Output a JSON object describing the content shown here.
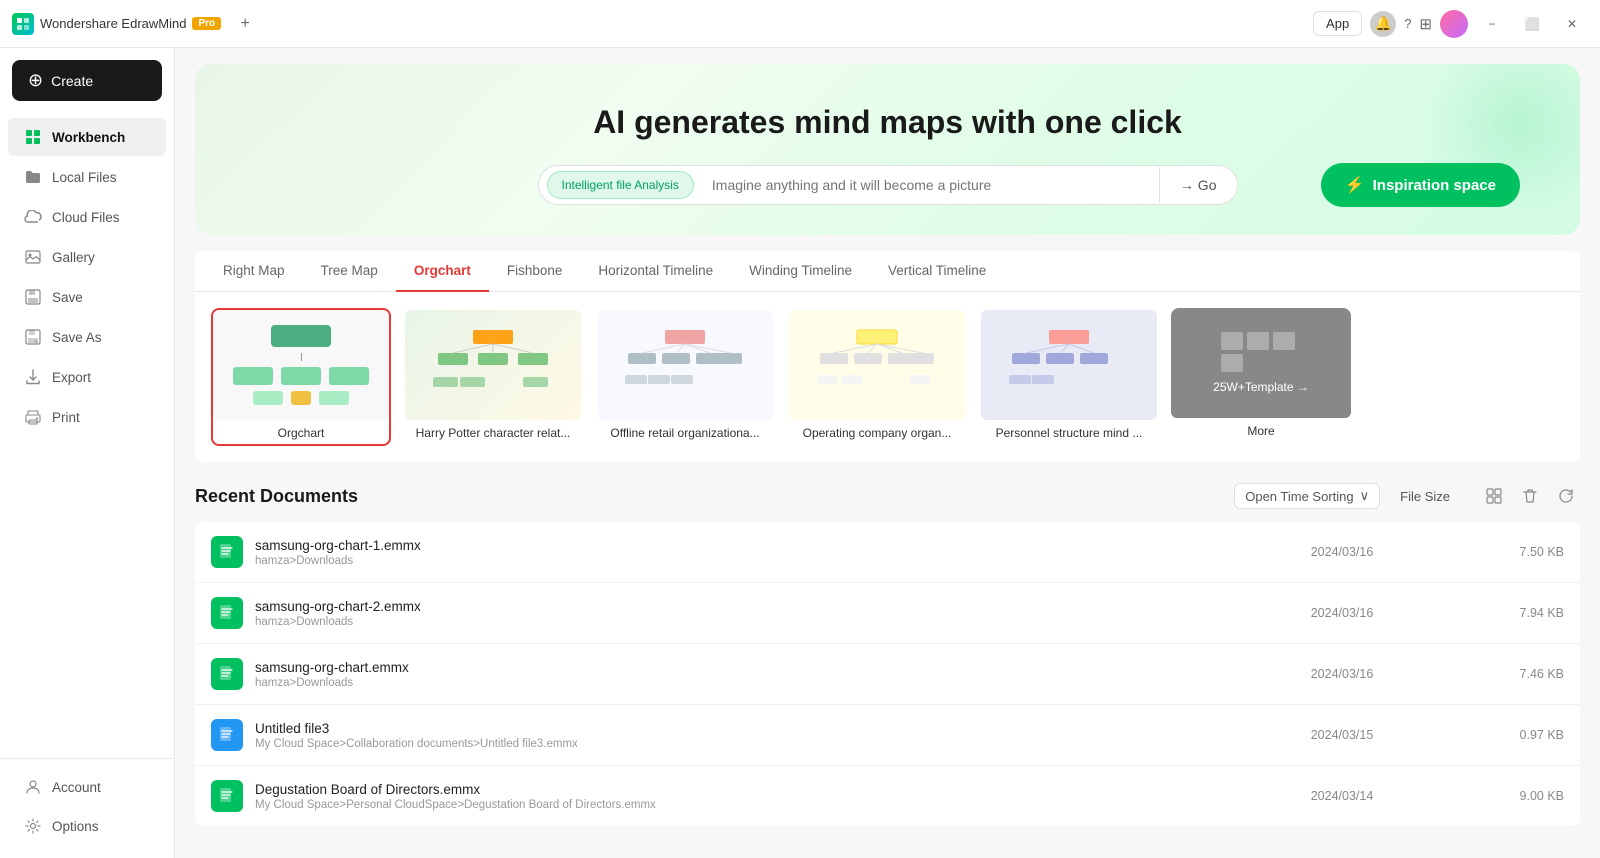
{
  "titleBar": {
    "appName": "Wondershare EdrawMind",
    "proBadge": "Pro",
    "addTabLabel": "+",
    "rightButtons": {
      "app": "App",
      "minimize": "−",
      "maximize": "⬜",
      "close": "✕"
    }
  },
  "sidebar": {
    "createLabel": "Create",
    "items": [
      {
        "id": "workbench",
        "label": "Workbench",
        "icon": "grid-icon",
        "active": true
      },
      {
        "id": "local-files",
        "label": "Local Files",
        "icon": "folder-icon",
        "active": false
      },
      {
        "id": "cloud-files",
        "label": "Cloud Files",
        "icon": "cloud-icon",
        "active": false
      },
      {
        "id": "gallery",
        "label": "Gallery",
        "icon": "gallery-icon",
        "active": false
      },
      {
        "id": "save",
        "label": "Save",
        "icon": "save-icon",
        "active": false
      },
      {
        "id": "save-as",
        "label": "Save As",
        "icon": "save-as-icon",
        "active": false
      },
      {
        "id": "export",
        "label": "Export",
        "icon": "export-icon",
        "active": false
      },
      {
        "id": "print",
        "label": "Print",
        "icon": "print-icon",
        "active": false
      }
    ],
    "bottomItems": [
      {
        "id": "account",
        "label": "Account",
        "icon": "account-icon"
      },
      {
        "id": "options",
        "label": "Options",
        "icon": "options-icon"
      }
    ]
  },
  "hero": {
    "title": "AI generates mind maps with one click",
    "searchTag": "Intelligent file Analysis",
    "searchPlaceholder": "Imagine anything and it will become a picture",
    "goLabel": "→ Go",
    "inspirationLabel": "Inspiration space"
  },
  "templateTabs": {
    "tabs": [
      {
        "id": "right-map",
        "label": "Right Map",
        "active": false
      },
      {
        "id": "tree-map",
        "label": "Tree Map",
        "active": false
      },
      {
        "id": "orgchart",
        "label": "Orgchart",
        "active": true
      },
      {
        "id": "fishbone",
        "label": "Fishbone",
        "active": false
      },
      {
        "id": "horizontal-timeline",
        "label": "Horizontal Timeline",
        "active": false
      },
      {
        "id": "winding-timeline",
        "label": "Winding Timeline",
        "active": false
      },
      {
        "id": "vertical-timeline",
        "label": "Vertical Timeline",
        "active": false
      }
    ],
    "cards": [
      {
        "id": "orgchart",
        "label": "Orgchart",
        "selected": true
      },
      {
        "id": "harry-potter",
        "label": "Harry Potter character relat...",
        "selected": false
      },
      {
        "id": "offline-retail",
        "label": "Offline retail organizationa...",
        "selected": false
      },
      {
        "id": "operating-company",
        "label": "Operating company organ...",
        "selected": false
      },
      {
        "id": "personnel-structure",
        "label": "Personnel structure mind ...",
        "selected": false
      }
    ],
    "moreCard": {
      "label": "25W+Template →",
      "moreText": "More"
    }
  },
  "recentDocuments": {
    "title": "Recent Documents",
    "sortLabel": "Open Time Sorting",
    "fileSizeLabel": "File Size",
    "docs": [
      {
        "id": "doc1",
        "name": "samsung-org-chart-1.emmx",
        "path": "hamza>Downloads",
        "date": "2024/03/16",
        "size": "7.50 KB",
        "iconColor": "green"
      },
      {
        "id": "doc2",
        "name": "samsung-org-chart-2.emmx",
        "path": "hamza>Downloads",
        "date": "2024/03/16",
        "size": "7.94 KB",
        "iconColor": "green"
      },
      {
        "id": "doc3",
        "name": "samsung-org-chart.emmx",
        "path": "hamza>Downloads",
        "date": "2024/03/16",
        "size": "7.46 KB",
        "iconColor": "green"
      },
      {
        "id": "doc4",
        "name": "Untitled file3",
        "path": "My Cloud Space>Collaboration documents>Untitled file3.emmx",
        "date": "2024/03/15",
        "size": "0.97 KB",
        "iconColor": "blue"
      },
      {
        "id": "doc5",
        "name": "Degustation Board of Directors.emmx",
        "path": "My Cloud Space>Personal CloudSpace>Degustation Board of Directors.emmx",
        "date": "2024/03/14",
        "size": "9.00 KB",
        "iconColor": "green"
      }
    ]
  }
}
